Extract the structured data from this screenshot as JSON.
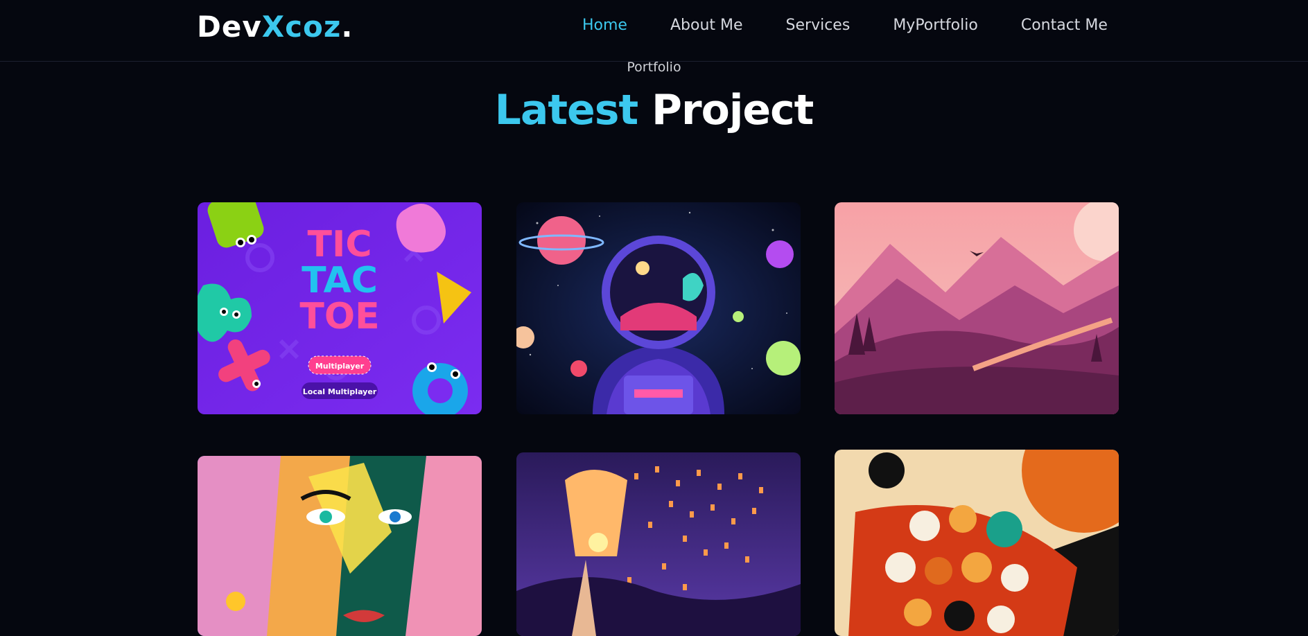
{
  "header": {
    "logo_main": "Dev",
    "logo_accent": "Xcoz",
    "logo_dot": ".",
    "nav": [
      {
        "label": "Home",
        "active": true
      },
      {
        "label": "About Me"
      },
      {
        "label": "Services"
      },
      {
        "label": "MyPortfolio"
      },
      {
        "label": "Contact Me"
      }
    ]
  },
  "section": {
    "eyebrow": "Portfolio",
    "title_accent": "Latest",
    "title_rest": " Project"
  },
  "colors": {
    "accent": "#3cc8ee",
    "background": "#05070f"
  },
  "projects": [
    {
      "name": "tic-tac-toe",
      "badge1": "Multiplayer",
      "badge2": "Local Multiplayer",
      "title_lines": [
        "TIC",
        "TAC",
        "TOE"
      ]
    },
    {
      "name": "astronaut"
    },
    {
      "name": "mountain-valley"
    },
    {
      "name": "abstract-face"
    },
    {
      "name": "sky-lanterns"
    },
    {
      "name": "faces-collage"
    }
  ]
}
